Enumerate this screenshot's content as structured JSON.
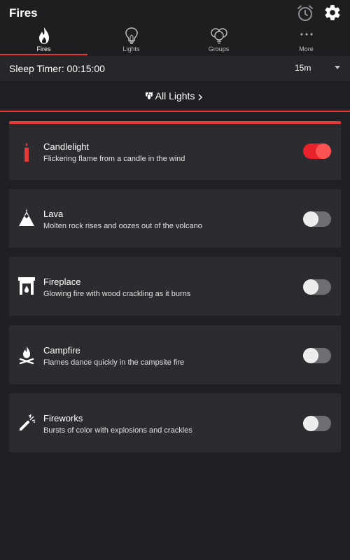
{
  "app": {
    "title": "Fires"
  },
  "tabs": [
    {
      "label": "Fires",
      "icon": "flame-icon",
      "active": true
    },
    {
      "label": "Lights",
      "icon": "bulb-icon",
      "active": false
    },
    {
      "label": "Groups",
      "icon": "bulbs-group-icon",
      "active": false
    },
    {
      "label": "More",
      "icon": "more-dots-icon",
      "active": false
    }
  ],
  "sleep_timer": {
    "label": "Sleep Timer: 00:15:00",
    "selected": "15m"
  },
  "all_lights": {
    "label": "All Lights"
  },
  "effects": [
    {
      "title": "Candlelight",
      "description": "Flickering flame from a candle in the wind",
      "icon": "candle-icon",
      "enabled": true
    },
    {
      "title": "Lava",
      "description": "Molten rock rises and oozes out of the volcano",
      "icon": "volcano-icon",
      "enabled": false
    },
    {
      "title": "Fireplace",
      "description": "Glowing fire with wood crackling as it burns",
      "icon": "fireplace-icon",
      "enabled": false
    },
    {
      "title": "Campfire",
      "description": "Flames dance quickly in the campsite fire",
      "icon": "campfire-icon",
      "enabled": false
    },
    {
      "title": "Fireworks",
      "description": "Bursts of color with explosions and crackles",
      "icon": "firework-icon",
      "enabled": false
    }
  ],
  "colors": {
    "accent": "#e53935",
    "background": "#202024",
    "card": "#2c2c30",
    "toggle_on": "#e8212a",
    "toggle_off": "#6f6f73"
  }
}
